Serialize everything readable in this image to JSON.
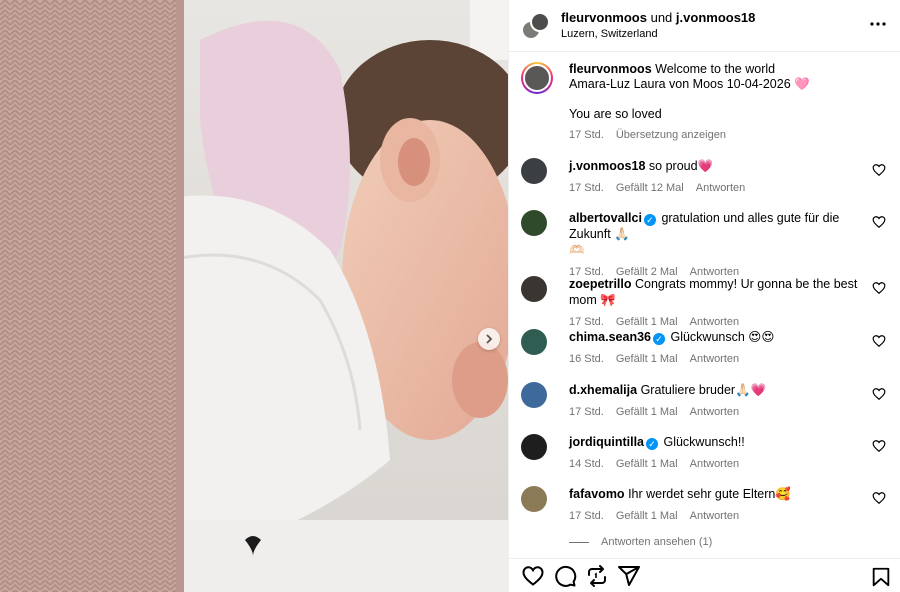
{
  "header": {
    "user1": "fleurvonmoos",
    "joiner": "und",
    "user2": "j.vonmoos18",
    "location": "Luzern, Switzerland"
  },
  "caption": {
    "username": "fleurvonmoos",
    "line1": "Welcome to the world",
    "line2": "Amara-Luz Laura von Moos 10-04-2026 🩷",
    "line3": "You are so loved",
    "time": "17 Std.",
    "translate": "Übersetzung anzeigen"
  },
  "comments": [
    {
      "username": "j.vonmoos18",
      "verified": false,
      "text": "so proud💗",
      "time": "17 Std.",
      "likes": "Gefällt 12 Mal",
      "reply": "Antworten",
      "avatar_color": "#3b3f44"
    },
    {
      "username": "albertovallci",
      "verified": true,
      "text": "gratulation und alles gute für die Zukunft 🙏🏻",
      "text2": "🫶🏻",
      "time": "17 Std.",
      "likes": "Gefällt 2 Mal",
      "reply": "Antworten",
      "avatar_color": "#2f4a2a"
    },
    {
      "username": "zoepetrillo",
      "verified": false,
      "text": "Congrats mommy! Ur gonna be the best mom 🎀",
      "time": "17 Std.",
      "likes": "Gefällt 1 Mal",
      "reply": "Antworten",
      "avatar_color": "#3a3530"
    },
    {
      "username": "chima.sean36",
      "verified": true,
      "text": "Glückwunsch 😍😍",
      "time": "16 Std.",
      "likes": "Gefällt 1 Mal",
      "reply": "Antworten",
      "avatar_color": "#2f5d52"
    },
    {
      "username": "d.xhemalija",
      "verified": false,
      "text": "Gratuliere bruder🙏🏻💗",
      "time": "17 Std.",
      "likes": "Gefällt 1 Mal",
      "reply": "Antworten",
      "avatar_color": "#3d6a9a"
    },
    {
      "username": "jordiquintilla",
      "verified": true,
      "text": "Glückwunsch!!",
      "time": "14 Std.",
      "likes": "Gefällt 1 Mal",
      "reply": "Antworten",
      "avatar_color": "#1e1e1e"
    },
    {
      "username": "fafavomo",
      "verified": false,
      "text": "Ihr werdet sehr gute Eltern🥰",
      "time": "17 Std.",
      "likes": "Gefällt 1 Mal",
      "reply": "Antworten",
      "avatar_color": "#8a7a55"
    }
  ],
  "view_replies": "Antworten ansehen (1)",
  "icons": [
    "heart-icon",
    "comment-icon",
    "repost-icon",
    "share-icon",
    "bookmark-icon",
    "more-icon",
    "chevron-right-icon",
    "verified-icon"
  ]
}
